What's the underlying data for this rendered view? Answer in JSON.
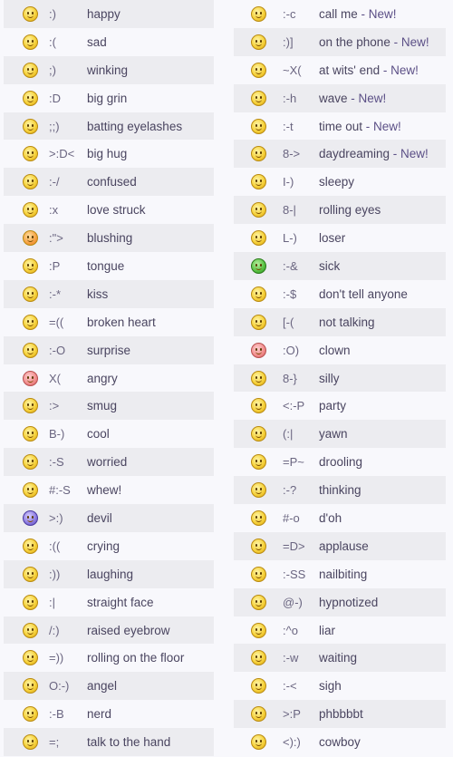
{
  "left_column": [
    {
      "icon": "happy-icon",
      "code": ":)",
      "label": "happy"
    },
    {
      "icon": "sad-icon",
      "code": ":(",
      "label": "sad"
    },
    {
      "icon": "winking-icon",
      "code": ";)",
      "label": "winking"
    },
    {
      "icon": "big-grin-icon",
      "code": ":D",
      "label": "big grin"
    },
    {
      "icon": "batting-eyelashes-icon",
      "code": ";;)",
      "label": "batting eyelashes"
    },
    {
      "icon": "big-hug-icon",
      "code": ">:D<",
      "label": "big hug"
    },
    {
      "icon": "confused-icon",
      "code": ":-/",
      "label": "confused"
    },
    {
      "icon": "love-struck-icon",
      "code": ":x",
      "label": "love struck"
    },
    {
      "icon": "blushing-icon",
      "code": ":\">",
      "label": "blushing"
    },
    {
      "icon": "tongue-icon",
      "code": ":P",
      "label": "tongue"
    },
    {
      "icon": "kiss-icon",
      "code": ":-*",
      "label": "kiss"
    },
    {
      "icon": "broken-heart-icon",
      "code": "=((",
      "label": "broken heart"
    },
    {
      "icon": "surprise-icon",
      "code": ":-O",
      "label": "surprise"
    },
    {
      "icon": "angry-icon",
      "code": "X(",
      "label": "angry"
    },
    {
      "icon": "smug-icon",
      "code": ":>",
      "label": "smug"
    },
    {
      "icon": "cool-icon",
      "code": "B-)",
      "label": "cool"
    },
    {
      "icon": "worried-icon",
      "code": ":-S",
      "label": "worried"
    },
    {
      "icon": "whew-icon",
      "code": "#:-S",
      "label": "whew!"
    },
    {
      "icon": "devil-icon",
      "code": ">:)",
      "label": "devil"
    },
    {
      "icon": "crying-icon",
      "code": ":((",
      "label": "crying"
    },
    {
      "icon": "laughing-icon",
      "code": ":))",
      "label": "laughing"
    },
    {
      "icon": "straight-face-icon",
      "code": ":|",
      "label": "straight face"
    },
    {
      "icon": "raised-eyebrow-icon",
      "code": "/:)",
      "label": "raised eyebrow"
    },
    {
      "icon": "rolling-on-the-floor-icon",
      "code": "=))",
      "label": "rolling on the floor"
    },
    {
      "icon": "angel-icon",
      "code": "O:-)",
      "label": "angel"
    },
    {
      "icon": "nerd-icon",
      "code": ":-B",
      "label": "nerd"
    },
    {
      "icon": "talk-to-the-hand-icon",
      "code": "=;",
      "label": "talk to the hand"
    }
  ],
  "right_column": [
    {
      "icon": "call-me-icon",
      "code": ":-c",
      "label": "call me",
      "suffix": " - New!"
    },
    {
      "icon": "on-the-phone-icon",
      "code": ":)]",
      "label": "on the phone",
      "suffix": " - New!"
    },
    {
      "icon": "at-wits-end-icon",
      "code": "~X(",
      "label": "at wits' end",
      "suffix": " - New!"
    },
    {
      "icon": "wave-icon",
      "code": ":-h",
      "label": "wave",
      "suffix": " - New!"
    },
    {
      "icon": "time-out-icon",
      "code": ":-t",
      "label": "time out",
      "suffix": " - New!"
    },
    {
      "icon": "daydreaming-icon",
      "code": "8->",
      "label": "daydreaming",
      "suffix": " - New!"
    },
    {
      "icon": "sleepy-icon",
      "code": "I-)",
      "label": "sleepy",
      "suffix": ""
    },
    {
      "icon": "rolling-eyes-icon",
      "code": "8-|",
      "label": "rolling eyes",
      "suffix": ""
    },
    {
      "icon": "loser-icon",
      "code": "L-)",
      "label": "loser",
      "suffix": ""
    },
    {
      "icon": "sick-icon",
      "code": ":-&",
      "label": "sick",
      "suffix": ""
    },
    {
      "icon": "dont-tell-anyone-icon",
      "code": ":-$",
      "label": "don't tell anyone",
      "suffix": ""
    },
    {
      "icon": "not-talking-icon",
      "code": "[-(",
      "label": "not talking",
      "suffix": ""
    },
    {
      "icon": "clown-icon",
      "code": ":O)",
      "label": "clown",
      "suffix": ""
    },
    {
      "icon": "silly-icon",
      "code": "8-}",
      "label": "silly",
      "suffix": ""
    },
    {
      "icon": "party-icon",
      "code": "<:-P",
      "label": "party",
      "suffix": ""
    },
    {
      "icon": "yawn-icon",
      "code": "(:|",
      "label": "yawn",
      "suffix": ""
    },
    {
      "icon": "drooling-icon",
      "code": "=P~",
      "label": "drooling",
      "suffix": ""
    },
    {
      "icon": "thinking-icon",
      "code": ":-?",
      "label": "thinking",
      "suffix": ""
    },
    {
      "icon": "doh-icon",
      "code": "#-o",
      "label": "d'oh",
      "suffix": ""
    },
    {
      "icon": "applause-icon",
      "code": "=D>",
      "label": "applause",
      "suffix": ""
    },
    {
      "icon": "nailbiting-icon",
      "code": ":-SS",
      "label": "nailbiting",
      "suffix": ""
    },
    {
      "icon": "hypnotized-icon",
      "code": "@-)",
      "label": "hypnotized",
      "suffix": ""
    },
    {
      "icon": "liar-icon",
      "code": ":^o",
      "label": "liar",
      "suffix": ""
    },
    {
      "icon": "waiting-icon",
      "code": ":-w",
      "label": "waiting",
      "suffix": ""
    },
    {
      "icon": "sigh-icon",
      "code": ":-<",
      "label": "sigh",
      "suffix": ""
    },
    {
      "icon": "phbbbbt-icon",
      "code": ">:P",
      "label": "phbbbbt",
      "suffix": ""
    },
    {
      "icon": "cowboy-icon",
      "code": "<):)",
      "label": "cowboy",
      "suffix": ""
    }
  ],
  "colors": {
    "row_shade": "#ececf0",
    "background": "#f8f8fc",
    "label_text": "#4a4560",
    "code_text": "#6a6580",
    "new_text": "#5b4f86"
  }
}
